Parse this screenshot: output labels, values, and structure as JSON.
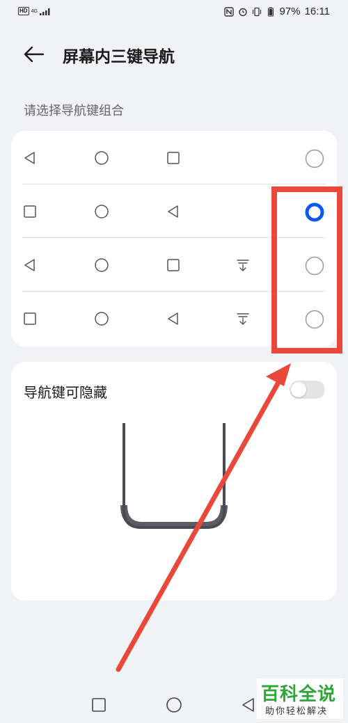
{
  "status_bar": {
    "left_badge": "HD",
    "network": "4G",
    "battery": "97%",
    "time": "16:11"
  },
  "header": {
    "title": "屏幕内三键导航",
    "back_icon": "arrow-left-icon"
  },
  "section": {
    "label": "请选择导航键组合"
  },
  "combinations": [
    {
      "keys": [
        "back",
        "home",
        "recent"
      ],
      "selected": false
    },
    {
      "keys": [
        "recent",
        "home",
        "back"
      ],
      "selected": true
    },
    {
      "keys": [
        "back",
        "home",
        "recent",
        "notification"
      ],
      "selected": false
    },
    {
      "keys": [
        "recent",
        "home",
        "back",
        "notification"
      ],
      "selected": false
    }
  ],
  "hide_option": {
    "label": "导航键可隐藏",
    "enabled": false
  },
  "colors": {
    "accent": "#0a59f7",
    "annotation": "#e8493a",
    "watermark_green": "#2fa537"
  },
  "watermark": {
    "title": "百科全说",
    "subtitle": "助你轻松解决"
  }
}
